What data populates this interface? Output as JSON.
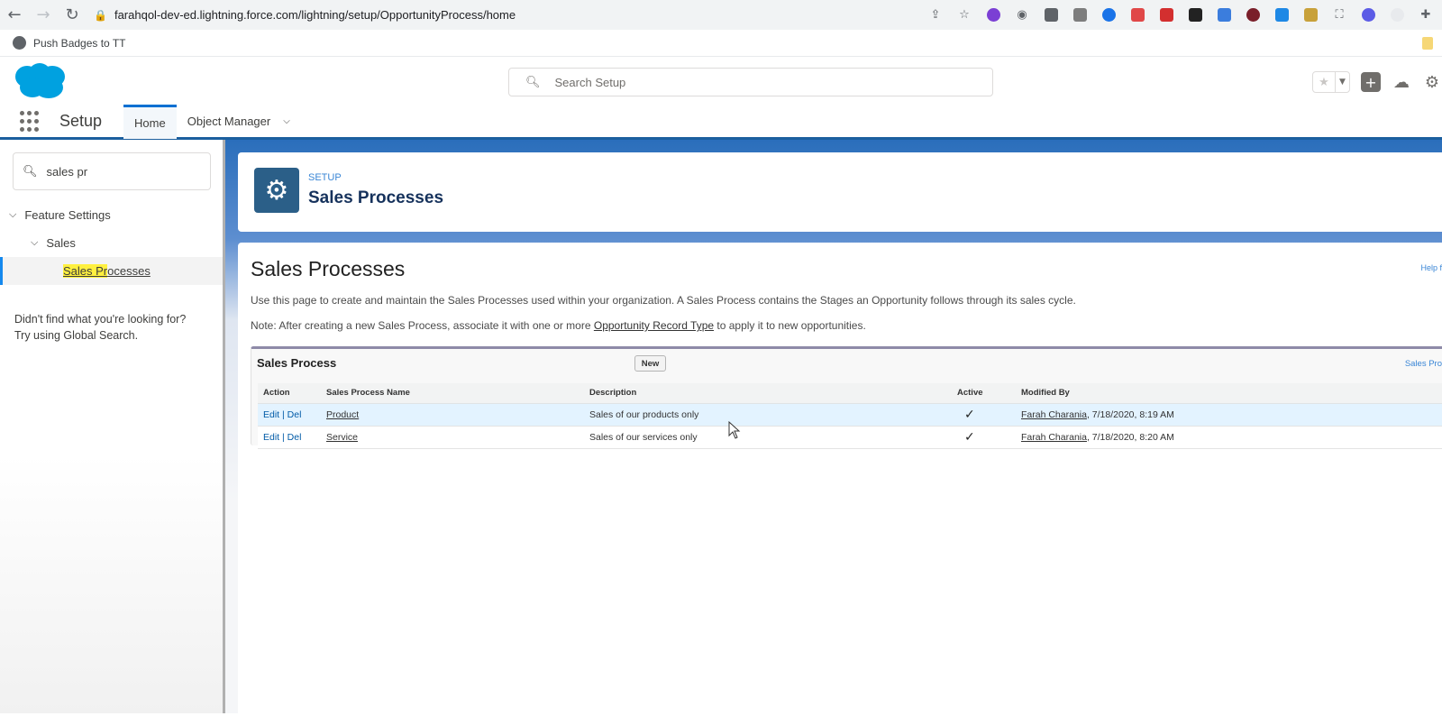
{
  "browser": {
    "url": "farahqol-dev-ed.lightning.force.com/lightning/setup/OpportunityProcess/home",
    "bookmark": "Push Badges to TT"
  },
  "header": {
    "search_placeholder": "Search Setup"
  },
  "nav": {
    "app_name": "Setup",
    "tabs": [
      {
        "label": "Home"
      },
      {
        "label": "Object Manager"
      }
    ]
  },
  "sidebar": {
    "quickfind_value": "sales pr",
    "tree": {
      "feature_settings": "Feature Settings",
      "sales": "Sales",
      "sales_processes_hl": "Sales Pr",
      "sales_processes_rest": "ocesses"
    },
    "help_line1": "Didn't find what you're looking for?",
    "help_line2": "Try using Global Search."
  },
  "page_header": {
    "label": "SETUP",
    "title": "Sales Processes"
  },
  "main": {
    "title": "Sales Processes",
    "help_link": "Help f",
    "description": "Use this page to create and maintain the Sales Processes used within your organization. A Sales Process contains the Stages an Opportunity follows through its sales cycle.",
    "note_prefix": "Note: After creating a new Sales Process, associate it with one or more ",
    "note_link": "Opportunity Record Type",
    "note_suffix": " to apply it to new opportunities.",
    "related_list": {
      "title": "Sales Process",
      "new_button": "New",
      "right_link": "Sales Pro",
      "columns": [
        "Action",
        "Sales Process Name",
        "Description",
        "Active",
        "Modified By"
      ],
      "rows": [
        {
          "edit": "Edit",
          "sep": " | ",
          "del": "Del",
          "name": "Product",
          "description": "Sales of our products only",
          "active": "✓",
          "modified_by": "Farah Charania",
          "modified_date": ", 7/18/2020, 8:19 AM"
        },
        {
          "edit": "Edit",
          "sep": " | ",
          "del": "Del",
          "name": "Service",
          "description": "Sales of our services only",
          "active": "✓",
          "modified_by": "Farah Charania",
          "modified_date": ", 7/18/2020, 8:20 AM"
        }
      ]
    }
  },
  "colors": {
    "brand_blue": "#00a1e0",
    "nav_border": "#1b5f9e",
    "setup_icon": "#2b5f88",
    "link": "#015ba7",
    "highlight": "#fff03f"
  }
}
